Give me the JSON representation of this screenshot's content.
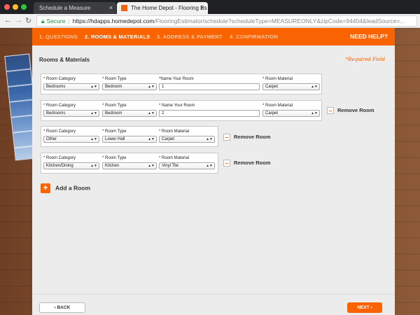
{
  "browser": {
    "tabs": [
      {
        "title": "Schedule a Measure",
        "close": "×"
      },
      {
        "title": "The Home Depot - Flooring Es",
        "close": "×"
      }
    ],
    "nav": {
      "back": "←",
      "forward": "→",
      "reload": "↻"
    },
    "url": {
      "lock": "🔒",
      "secure": "Secure",
      "host": "https://hdapps.homedepot.com",
      "path": "/FlooringEstimator/schedule?scheduleType=MEASUREONLY&zipCode=94404&leadSource=..."
    }
  },
  "steps": [
    {
      "label": "1. QUESTIONS",
      "active": false
    },
    {
      "label": "2. ROOMS & MATERIALS",
      "active": true
    },
    {
      "label": "3. ADDRESS & PAYMENT",
      "active": false
    },
    {
      "label": "4. CONFIRMATION",
      "active": false
    }
  ],
  "need_help": "NEED HELP?",
  "section_title": "Rooms & Materials",
  "required_note": "*Required Field",
  "labels": {
    "room_category": "* Room Category",
    "room_type": "* Room Type",
    "name_room": "*Name Your Room",
    "name_room_alt": "* Name Your Room",
    "room_material": "* Room Material",
    "room_material_short": "*Room Material"
  },
  "rooms": [
    {
      "category": "Bedrooms",
      "type": "Bedroom",
      "name": "1",
      "material": "Carpet",
      "remove": ""
    },
    {
      "category": "Bedrooms",
      "type": "Bedroom",
      "name": "2",
      "material": "Carpet",
      "remove": "Remove Room"
    },
    {
      "category": "Other",
      "type": "Lower Hall",
      "material": "Carpet",
      "remove": "Remove Room"
    },
    {
      "category": "Kitchen/Dining",
      "type": "Kitchen",
      "material": "Vinyl Tile",
      "remove": "Remove Room"
    }
  ],
  "add_room": "Add a Room",
  "buttons": {
    "back": "‹ BACK",
    "next": "NEXT ›"
  },
  "colors": {
    "brand_orange": "#f96302"
  }
}
